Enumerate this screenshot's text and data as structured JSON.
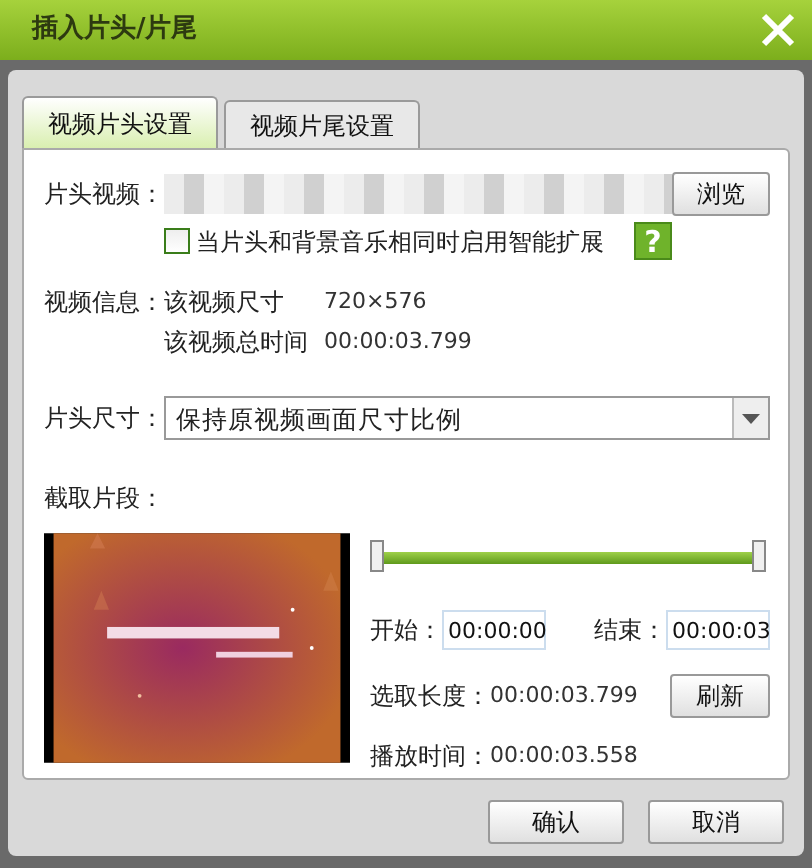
{
  "window": {
    "title": "插入片头/片尾"
  },
  "tabs": [
    {
      "label": "视频片头设置",
      "selected": true
    },
    {
      "label": "视频片尾设置",
      "selected": false
    }
  ],
  "file_row": {
    "label": "片头视频：",
    "button": "浏览"
  },
  "smart_expand": {
    "label": "当片头和背景音乐相同时启用智能扩展",
    "checked": false,
    "help": "?"
  },
  "video_info": {
    "label": "视频信息：",
    "size_label": "该视频尺寸",
    "size": "720×576",
    "duration_label": "该视频总时间",
    "duration": "00:00:03.799"
  },
  "intro_size": {
    "label": "片头尺寸：",
    "value": "保持原视频画面尺寸比例"
  },
  "clip": {
    "label": "截取片段：",
    "slider": {
      "level": 1
    },
    "start_label": "开始：",
    "start": "00:00:00",
    "end_label": "结束：",
    "end": "00:00:03",
    "length_label": "选取长度：",
    "length": "00:00:03.799",
    "refresh": "刷新",
    "play_label": "播放时间：",
    "play": "00:00:03.558"
  },
  "buttons": [
    "确认",
    "取消"
  ]
}
